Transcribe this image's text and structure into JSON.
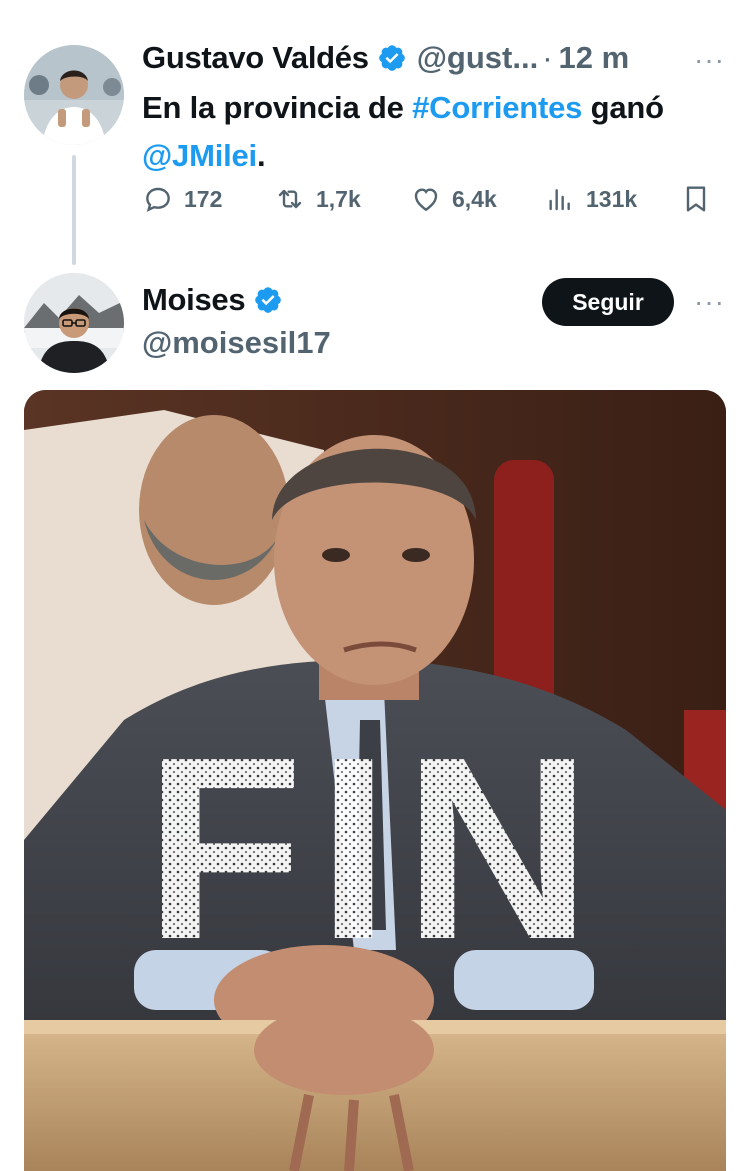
{
  "tweet1": {
    "display_name": "Gustavo Valdés",
    "handle": "@gust...",
    "separator": "·",
    "time": "12 m",
    "more": "···",
    "text_prefix": "En la provincia de ",
    "hashtag": "#Corrientes",
    "text_mid": " ganó",
    "mention": "@JMilei",
    "text_suffix": ".",
    "actions": {
      "replies": "172",
      "retweets": "1,7k",
      "likes": "6,4k",
      "views": "131k"
    }
  },
  "tweet2": {
    "display_name": "Moises",
    "handle": "@moisesil17",
    "follow_label": "Seguir",
    "more": "···",
    "image_caption": "FIN"
  },
  "colors": {
    "link": "#1d9bf0",
    "text": "#0f1419",
    "secondary": "#536471",
    "verified": "#1d9bf0"
  }
}
